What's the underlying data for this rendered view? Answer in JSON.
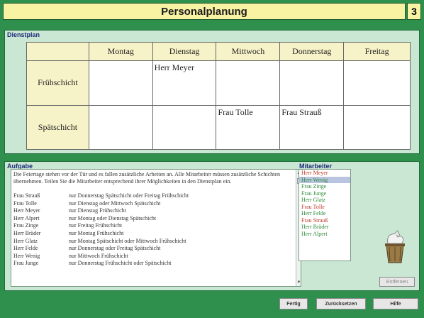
{
  "title": "Personalplanung",
  "page_number": "3",
  "schedule": {
    "label": "Dienstplan",
    "days": [
      "Montag",
      "Dienstag",
      "Mittwoch",
      "Donnerstag",
      "Freitag"
    ],
    "shifts": [
      {
        "name": "Frühschicht",
        "cells": [
          "",
          "Herr Meyer",
          "",
          "",
          ""
        ]
      },
      {
        "name": "Spätschicht",
        "cells": [
          "",
          "",
          "Frau Tolle",
          "Frau Strauß",
          ""
        ]
      }
    ]
  },
  "task": {
    "label": "Aufgabe",
    "intro": "Die Feiertage stehen vor der Tür und es fallen zusätzliche Arbeiten an. Alle Mitarbeiter müssen zusätzliche Schichten übernehmen. Teilen Sie die Mitarbeiter entsprechend ihrer Möglichkeiten in den Dienstplan ein.",
    "constraints": [
      {
        "name": "Frau Strauß",
        "text": "nur Donnerstag Spätschicht oder Freitag Frühschicht"
      },
      {
        "name": "Frau Tolle",
        "text": "nur Dienstag oder Mittwoch Spätschicht"
      },
      {
        "name": "Herr Meyer",
        "text": "nur Dienstag Frühschicht"
      },
      {
        "name": "Herr Alpert",
        "text": "nur Montag oder Dienstag Spätschicht"
      },
      {
        "name": "Frau Zinge",
        "text": "nur Freitag Frühschicht"
      },
      {
        "name": "Herr Bräder",
        "text": "nur Montag Frühschicht"
      },
      {
        "name": "Herr Glatz",
        "text": "nur Montag Spätschicht oder Mittwoch Frühschicht"
      },
      {
        "name": "Herr Felde",
        "text": "nur Donnerstag oder Freitag Spätschicht"
      },
      {
        "name": "Herr Wenig",
        "text": "nur Mittwoch Frühschicht"
      },
      {
        "name": "Frau Junge",
        "text": "nur Donnerstag Frühschicht oder Spätschicht"
      }
    ]
  },
  "employees": {
    "label": "Mitarbeiter",
    "items": [
      {
        "name": "Herr Meyer",
        "color": "#c0392b"
      },
      {
        "name": "Herr Wenig",
        "color": "#2e8b3a",
        "selected": true
      },
      {
        "name": "Frau Zinge",
        "color": "#2e8b3a"
      },
      {
        "name": "Frau Junge",
        "color": "#2e8b3a"
      },
      {
        "name": "Herr Glatz",
        "color": "#2e8b3a"
      },
      {
        "name": "Frau Tolle",
        "color": "#c0392b"
      },
      {
        "name": "Herr Felde",
        "color": "#2e8b3a"
      },
      {
        "name": "Frau Strauß",
        "color": "#c0392b"
      },
      {
        "name": "Herr Bräder",
        "color": "#2e8b3a"
      },
      {
        "name": "Herr Alpert",
        "color": "#2e8b3a"
      }
    ],
    "remove_button": "Entfernen"
  },
  "buttons": {
    "done": "Fertig",
    "back": "Zurücksetzen",
    "help": "Hilfe"
  }
}
